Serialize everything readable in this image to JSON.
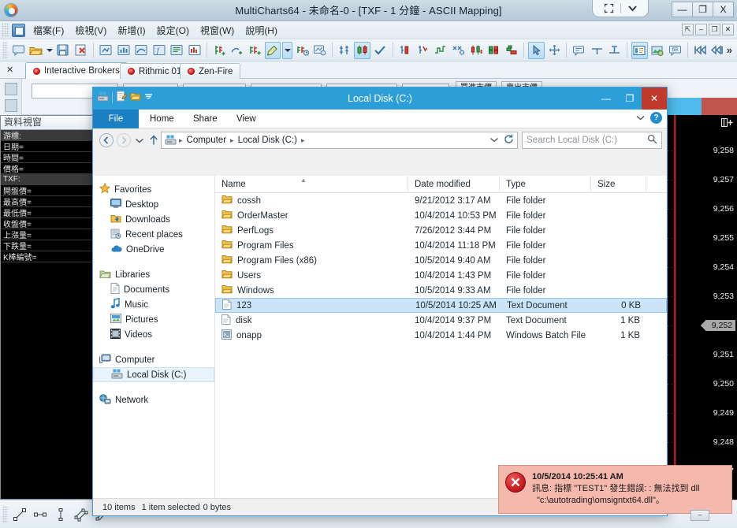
{
  "app": {
    "title": "MultiCharts64 - 未命名-0 - [TXF - 1 分鐘 - ASCII Mapping]",
    "logo_icon": "multicharts-logo-icon",
    "titlebar_tools": {
      "expand_icon": "expand-arrows-icon",
      "chevron_icon": "chevron-down-icon"
    },
    "sysbuttons": [
      {
        "name": "minimize-button",
        "glyph": "—"
      },
      {
        "name": "maximize-button",
        "glyph": "❐"
      },
      {
        "name": "close-button",
        "glyph": "X"
      }
    ],
    "menu": [
      {
        "label": "檔案(F)"
      },
      {
        "label": "檢視(V)"
      },
      {
        "label": "新增(I)"
      },
      {
        "label": "設定(O)"
      },
      {
        "label": "視窗(W)"
      },
      {
        "label": "說明(H)"
      }
    ],
    "mdi_buttons": [
      {
        "name": "mdi-restore-outer-button",
        "glyph": "⇱"
      },
      {
        "name": "mdi-minimize-button",
        "glyph": "–"
      },
      {
        "name": "mdi-restore-button",
        "glyph": "❐"
      },
      {
        "name": "mdi-close-button",
        "glyph": "✕"
      }
    ],
    "toolbar_overflow": "»"
  },
  "broker_tabs": [
    {
      "label": "Interactive Brokers",
      "selected": true
    },
    {
      "label": "Rithmic 01",
      "selected": false
    },
    {
      "label": "Zen-Fire",
      "selected": false
    }
  ],
  "order_panel": {
    "buttons": [
      {
        "label": "買進市價"
      },
      {
        "label": "賣出市價"
      }
    ]
  },
  "data_window": {
    "title": "資料視窗",
    "rows": [
      {
        "label": "游標:",
        "value": "",
        "group": true
      },
      {
        "label": "日期=",
        "value": ""
      },
      {
        "label": "時間=",
        "value": ""
      },
      {
        "label": "價格=",
        "value": ""
      },
      {
        "label": "TXF:",
        "value": "",
        "group": true
      },
      {
        "label": "開盤價=",
        "value": ""
      },
      {
        "label": "最高價=",
        "value": ""
      },
      {
        "label": "最低價=",
        "value": ""
      },
      {
        "label": "收盤價=",
        "value": ""
      },
      {
        "label": "上漲量=",
        "value": ""
      },
      {
        "label": "下跌量=",
        "value": ""
      },
      {
        "label": "K棒編號=",
        "value": ""
      }
    ]
  },
  "chart": {
    "axis_header_icon": "calendar-plus-icon",
    "price_ticks": [
      "9,258",
      "9,257",
      "9,256",
      "9,255",
      "9,254",
      "9,253",
      "9,251",
      "9,250",
      "9,249",
      "9,248",
      "9,247"
    ],
    "current_price": "9,252"
  },
  "explorer": {
    "title": "Local Disk (C:)",
    "quick_access": [
      {
        "name": "drive-icon"
      },
      {
        "name": "properties-icon"
      },
      {
        "name": "new-folder-icon"
      },
      {
        "name": "customize-chevron-icon"
      }
    ],
    "sysbuttons": [
      {
        "name": "minimize-button",
        "glyph": "—"
      },
      {
        "name": "maximize-button",
        "glyph": "❐"
      },
      {
        "name": "close-button",
        "glyph": "✕"
      }
    ],
    "ribbon": {
      "file_label": "File",
      "tabs": [
        "Home",
        "Share",
        "View"
      ],
      "collapse_icon": "chevron-down-icon",
      "help_label": "?"
    },
    "address": {
      "back_icon": "back-arrow-icon",
      "forward_icon": "forward-arrow-icon",
      "recent_icon": "chevron-down-icon",
      "up_icon": "up-arrow-icon",
      "drive_icon": "local-disk-icon",
      "crumbs": [
        "Computer",
        "Local Disk (C:)"
      ],
      "dropdown_icon": "chevron-down-icon",
      "refresh_icon": "refresh-icon",
      "search_placeholder": "Search Local Disk (C:)",
      "search_icon": "search-icon"
    },
    "nav": {
      "groups": [
        {
          "header": {
            "label": "Favorites",
            "icon": "star-icon"
          },
          "items": [
            {
              "label": "Desktop",
              "icon": "desktop-icon"
            },
            {
              "label": "Downloads",
              "icon": "downloads-icon"
            },
            {
              "label": "Recent places",
              "icon": "recent-places-icon"
            },
            {
              "label": "OneDrive",
              "icon": "onedrive-cloud-icon"
            }
          ]
        },
        {
          "header": {
            "label": "Libraries",
            "icon": "libraries-icon"
          },
          "items": [
            {
              "label": "Documents",
              "icon": "documents-icon"
            },
            {
              "label": "Music",
              "icon": "music-note-icon"
            },
            {
              "label": "Pictures",
              "icon": "pictures-icon"
            },
            {
              "label": "Videos",
              "icon": "videos-icon"
            }
          ]
        },
        {
          "header": {
            "label": "Computer",
            "icon": "computer-icon"
          },
          "items": [
            {
              "label": "Local Disk (C:)",
              "icon": "local-disk-icon",
              "selected": true
            }
          ]
        },
        {
          "header": {
            "label": "Network",
            "icon": "network-icon"
          },
          "items": []
        }
      ]
    },
    "list": {
      "columns": [
        "Name",
        "Date modified",
        "Type",
        "Size"
      ],
      "sort_indicator": "ascending",
      "rows": [
        {
          "name": "cossh",
          "date": "9/21/2012 3:17 AM",
          "type": "File folder",
          "size": "",
          "icon": "folder-icon"
        },
        {
          "name": "OrderMaster",
          "date": "10/4/2014 10:53 PM",
          "type": "File folder",
          "size": "",
          "icon": "folder-icon"
        },
        {
          "name": "PerfLogs",
          "date": "7/26/2012 3:44 PM",
          "type": "File folder",
          "size": "",
          "icon": "folder-icon"
        },
        {
          "name": "Program Files",
          "date": "10/4/2014 11:18 PM",
          "type": "File folder",
          "size": "",
          "icon": "folder-icon"
        },
        {
          "name": "Program Files (x86)",
          "date": "10/5/2014 9:40 AM",
          "type": "File folder",
          "size": "",
          "icon": "folder-icon"
        },
        {
          "name": "Users",
          "date": "10/4/2014 1:43 PM",
          "type": "File folder",
          "size": "",
          "icon": "folder-icon"
        },
        {
          "name": "Windows",
          "date": "10/5/2014 9:33 AM",
          "type": "File folder",
          "size": "",
          "icon": "folder-icon"
        },
        {
          "name": "123",
          "date": "10/5/2014 10:25 AM",
          "type": "Text Document",
          "size": "0 KB",
          "icon": "text-document-icon",
          "selected": true
        },
        {
          "name": "disk",
          "date": "10/4/2014 9:37 PM",
          "type": "Text Document",
          "size": "1 KB",
          "icon": "text-document-icon"
        },
        {
          "name": "onapp",
          "date": "10/4/2014 1:44 PM",
          "type": "Windows Batch File",
          "size": "1 KB",
          "icon": "batch-file-icon"
        }
      ]
    },
    "status": {
      "items_count": "10 items",
      "selection": "1 item selected",
      "selection_size": "0 bytes"
    }
  },
  "toast": {
    "icon": "error-x-icon",
    "timestamp": "10/5/2014 10:25:41 AM",
    "message_line1": "訊息: 指標 \"TEST1\" 發生錯誤: : 無法找到 dll",
    "message_line2": "\"c:\\autotrading\\omsigntxt64.dll\"。",
    "minimize_glyph": "–"
  },
  "colors": {
    "explorer_accent": "#2c9fd9",
    "close_red": "#c0392b",
    "selection_blue": "#cce4f7",
    "toast_bg": "#f5b8ad",
    "chart_bg": "#000000",
    "cursor_red": "#d01010"
  }
}
